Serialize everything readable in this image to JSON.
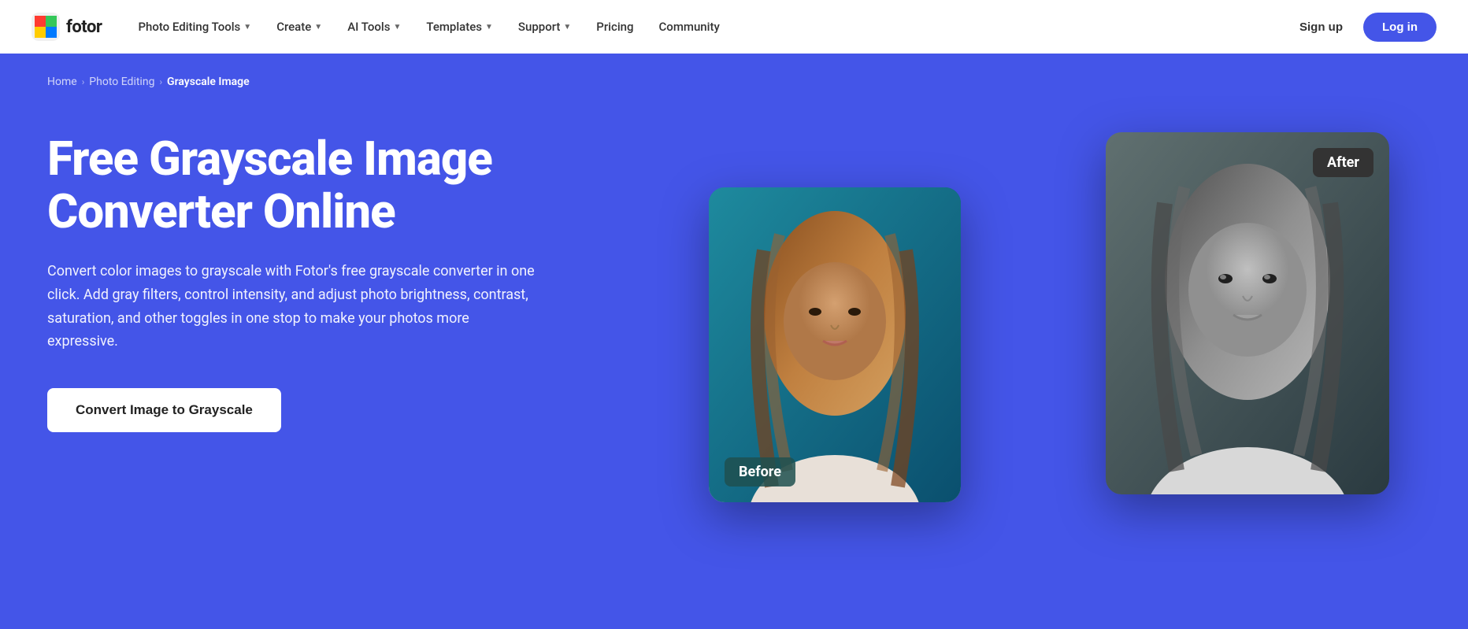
{
  "logo": {
    "name": "fotor",
    "alt": "Fotor logo"
  },
  "nav": {
    "items": [
      {
        "label": "Photo Editing Tools",
        "has_dropdown": true
      },
      {
        "label": "Create",
        "has_dropdown": true
      },
      {
        "label": "AI Tools",
        "has_dropdown": true
      },
      {
        "label": "Templates",
        "has_dropdown": true
      },
      {
        "label": "Support",
        "has_dropdown": true
      },
      {
        "label": "Pricing",
        "has_dropdown": false
      },
      {
        "label": "Community",
        "has_dropdown": false
      }
    ],
    "signup_label": "Sign up",
    "login_label": "Log in"
  },
  "breadcrumb": {
    "home": "Home",
    "parent": "Photo Editing",
    "current": "Grayscale Image"
  },
  "hero": {
    "title": "Free Grayscale Image Converter Online",
    "description": "Convert color images to grayscale with Fotor's free grayscale converter in one click. Add gray filters, control intensity, and adjust photo brightness, contrast, saturation, and other toggles in one stop to make your photos more expressive.",
    "cta_label": "Convert Image to Grayscale"
  },
  "before_after": {
    "before_label": "Before",
    "after_label": "After"
  },
  "colors": {
    "hero_bg": "#4455e8",
    "nav_bg": "#ffffff",
    "cta_bg": "#ffffff",
    "cta_text": "#222222",
    "login_bg": "#4455e8"
  }
}
